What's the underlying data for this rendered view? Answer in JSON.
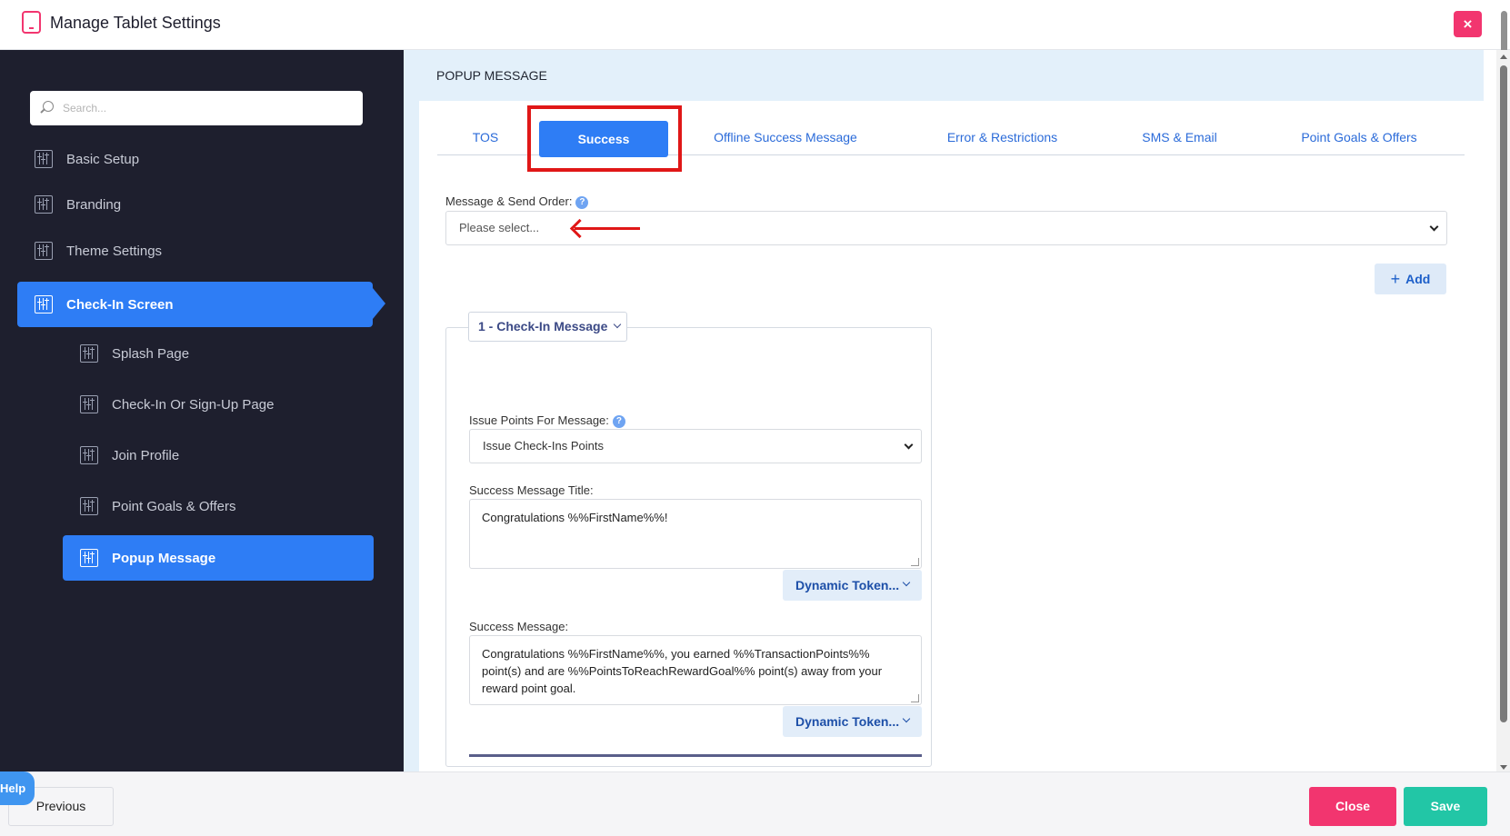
{
  "window": {
    "title": "Manage Tablet Settings",
    "app_icon": "tablet-icon",
    "close_icon": "close-icon",
    "close_glyph": "×"
  },
  "sidebar": {
    "search_placeholder": "Search...",
    "items": [
      {
        "label": "Basic Setup",
        "icon": "sliders-icon"
      },
      {
        "label": "Branding",
        "icon": "sliders-icon"
      },
      {
        "label": "Theme Settings",
        "icon": "sliders-icon"
      },
      {
        "label": "Check-In Screen",
        "icon": "sliders-icon",
        "active": true
      },
      {
        "label": "Splash Page",
        "icon": "sliders-icon"
      },
      {
        "label": "Check-In Or Sign-Up Page",
        "icon": "sliders-icon"
      },
      {
        "label": "Join Profile",
        "icon": "sliders-icon"
      },
      {
        "label": "Point Goals & Offers",
        "icon": "sliders-icon"
      },
      {
        "label": "Popup Message",
        "icon": "sliders-icon",
        "active": true
      }
    ]
  },
  "main": {
    "section_title": "POPUP MESSAGE",
    "tabs": [
      {
        "label": "TOS"
      },
      {
        "label": "Success",
        "active": true
      },
      {
        "label": "Offline Success Message"
      },
      {
        "label": "Error & Restrictions"
      },
      {
        "label": "SMS & Email"
      },
      {
        "label": "Point Goals & Offers"
      }
    ],
    "message_order": {
      "label": "Message & Send Order:",
      "value": "Please select..."
    },
    "add_button": {
      "label": "Add",
      "glyph": "+"
    },
    "help_glyph": "?",
    "panel": {
      "title": "1 - Check-In Message",
      "issue_points": {
        "label": "Issue Points For Message:",
        "value": "Issue Check-Ins Points"
      },
      "success_title": {
        "label": "Success Message Title:",
        "value": "Congratulations %%FirstName%%!"
      },
      "success_message": {
        "label": "Success Message:",
        "value": "Congratulations %%FirstName%%, you earned %%TransactionPoints%% point(s) and are %%PointsToReachRewardGoal%% point(s) away from your reward point goal."
      },
      "token_button": "Dynamic Token..."
    }
  },
  "footer": {
    "help": "Help",
    "previous": "Previous",
    "close": "Close",
    "save": "Save"
  },
  "colors": {
    "accent": "#2e7df5",
    "danger": "#f2356f",
    "success": "#22c6a6",
    "sidebar_bg": "#1e1f2e",
    "annotation_red": "#e01717"
  }
}
